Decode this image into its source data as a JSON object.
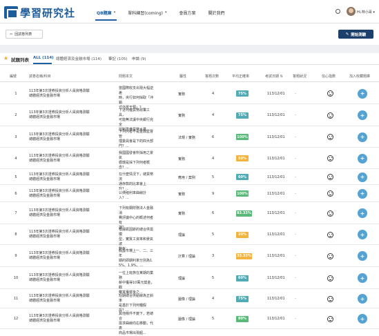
{
  "nav": {
    "logo_text": "學習研究社",
    "menu": [
      {
        "label": "QB題庫",
        "active": true,
        "has_caret": true
      },
      {
        "label": "單科練習(coming)",
        "active": false,
        "has_caret": true
      },
      {
        "label": "會員方案",
        "active": false,
        "has_caret": false
      },
      {
        "label": "關於我們",
        "active": false,
        "has_caret": false
      }
    ],
    "user_label": "Hi,林小哥 ▾"
  },
  "toolbar": {
    "back_label": "回試卷列表",
    "start_label": "開始測驗"
  },
  "tabs": {
    "title": "試題列表",
    "items": [
      {
        "label": "ALL (114)",
        "active": true
      },
      {
        "label": "總體經濟及金融市場 (114)",
        "active": false
      },
      {
        "label": "筆記 (105)",
        "active": false
      },
      {
        "label": "申論 (9)",
        "active": false
      }
    ]
  },
  "table": {
    "headers": [
      "編號",
      "試卷名稱/科目",
      "問題本文",
      "屬性",
      "答題次數",
      "平均正確率",
      "考試日期",
      "答題狀況",
      "信心指數",
      "加入收藏題庫"
    ],
    "sort_indicator": "⇅",
    "rows": [
      {
        "num": "1",
        "name1": "113年第3次證券投資分析人員資格測驗",
        "name2": "總體經濟及金融市場",
        "q": [
          "當國際收支出現大幅逆差",
          "時，央行如何採取「沖銷",
          "式外匯干預」？..."
        ],
        "attr": "實務",
        "count": "4",
        "rate": "75%",
        "rate_color": "teal",
        "date": "113/12/01",
        "status": "-"
      },
      {
        "num": "2",
        "name1": "113年第3次證券投資分析人員資格測驗",
        "name2": "總體經濟及金融市場",
        "q": [
          "下述何種貨幣政策工具，",
          "可能無法讓中央銀行完全",
          "控制準備貨幣水準..."
        ],
        "attr": "實務",
        "count": "4",
        "rate": "75%",
        "rate_color": "teal",
        "date": "113/12/01",
        "status": "-"
      },
      {
        "num": "3",
        "name1": "113年第3次證券投資分析人員資格測驗",
        "name2": "總體經濟及金融市場",
        "q": [
          "下列何者不是金融監督管",
          "理委員會是下的四大部",
          "門？..."
        ],
        "attr": "法規 / 實務",
        "count": "6",
        "rate": "100%",
        "rate_color": "green",
        "date": "113/12/01",
        "status": "-"
      },
      {
        "num": "4",
        "name1": "113年第3次證券投資分析人員資格測驗",
        "name2": "總體經濟及金融市場",
        "q": [
          "我國國發會所採用之景氣",
          "循環是採下列何者概",
          "念？..."
        ],
        "attr": "實務",
        "count": "4",
        "rate": "50%",
        "rate_color": "yellow",
        "date": "113/12/01",
        "status": "-"
      },
      {
        "num": "5",
        "name1": "113年第3次證券投資分析人員資格測驗",
        "name2": "總體經濟及金融市場",
        "q": [
          "在什麼情況下，總貨幣流",
          "通存款的比率會上升？..."
        ],
        "attr": "應用 / 案例",
        "count": "5",
        "rate": "60%",
        "rate_color": "teal",
        "date": "113/12/01",
        "status": "-"
      },
      {
        "num": "6",
        "name1": "113年第3次證券投資分析人員資格測驗",
        "name2": "總體經濟及金融市場",
        "q": [
          "公債殖利率曲線計入？..."
        ],
        "attr": "實務",
        "count": "9",
        "rate": "100%",
        "rate_color": "green",
        "date": "113/12/01",
        "status": "-"
      },
      {
        "num": "7",
        "name1": "113年第3次證券投資分析人員資格測驗",
        "name2": "總體經濟及金融市場",
        "q": [
          "下列有關財務法人金融消",
          "費評議中心的概述何者有",
          "誤？..."
        ],
        "attr": "實務",
        "count": "6",
        "rate": "83.33%",
        "rate_color": "green",
        "date": "113/12/01",
        "status": "-"
      },
      {
        "num": "8",
        "name1": "113年第3次證券投資分析人員資格測驗",
        "name2": "總體經濟及金融市場",
        "q": [
          "根據凱因斯的總合供需模",
          "型，實質工資率和景氣波",
          "動有：..."
        ],
        "attr": "理論",
        "count": "5",
        "rate": "20%",
        "rate_color": "yellow",
        "date": "113/12/01",
        "status": "-"
      },
      {
        "num": "9",
        "name1": "113年第3次證券投資分析人員資格測驗",
        "name2": "總體經濟及金融市場",
        "q": [
          "假設市場上一、二、三年",
          "期的即期利率分別為1.",
          "5%、1.9%、..."
        ],
        "attr": "計算 / 理論",
        "count": "3",
        "rate": "33.33%",
        "rate_color": "yellow",
        "date": "113/12/01",
        "status": "-"
      },
      {
        "num": "10",
        "name1": "113年第3次證券投資分析人員資格測驗",
        "name2": "總體經濟及金融市場",
        "q": [
          "一位上班族在某期的業務",
          "薪中獲得10萬元獎金，觀",
          "察其獲獎後之..."
        ],
        "attr": "理論",
        "count": "5",
        "rate": "60%",
        "rate_color": "teal",
        "date": "113/12/01",
        "status": "-"
      },
      {
        "num": "11",
        "name1": "113年第3次證券投資分析人員資格測驗",
        "name2": "總體經濟及金融市場",
        "q": [
          "短期總合供給線為正斜率",
          "是基於下列何種假設？..."
        ],
        "attr": "圖像 / 理論",
        "count": "4",
        "rate": "75%",
        "rate_color": "teal",
        "date": "113/12/01",
        "status": "-"
      },
      {
        "num": "12",
        "name1": "113年第3次證券投資分析人員資格測驗",
        "name2": "總體經濟及金融市場",
        "q": [
          "其他條件不變下，若總合",
          "需求曲線向右移動，代表",
          "商品市場出現超..."
        ],
        "attr": "圖像 / 理論",
        "count": "5",
        "rate": "80%",
        "rate_color": "green",
        "date": "113/12/01",
        "status": "-"
      }
    ]
  },
  "colors": {
    "brand": "#1d5d9b",
    "accent": "#1f5f9f",
    "start_button": "#1c3f6b",
    "add_button": "#54a3d2",
    "green": "#5ab878",
    "teal": "#52aab4",
    "yellow": "#f2b43e"
  },
  "icons": {
    "back": "arrow-left-icon",
    "start": "pencil-icon",
    "favorite": "star-icon",
    "settings": "gear-icon",
    "confidence": "neutral-face-icon",
    "add": "plus-icon"
  }
}
